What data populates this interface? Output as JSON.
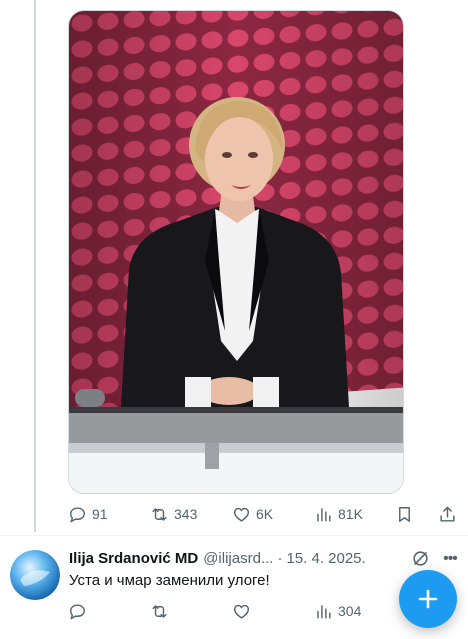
{
  "post": {
    "media": {
      "alt": "News anchor image"
    },
    "stats": {
      "replies": "91",
      "reposts": "343",
      "likes": "6K",
      "views": "81K"
    }
  },
  "reply": {
    "name": "Ilija Srdanović MD",
    "handle": "@ilijasrd...",
    "separator": "·",
    "date": "15. 4. 2025.",
    "text": "Уста и чмар заменили улоге!",
    "views": "304"
  },
  "icons": {
    "reply": "reply-icon",
    "repost": "repost-icon",
    "like": "heart-icon",
    "views": "views-icon",
    "bookmark": "bookmark-icon",
    "share": "share-icon",
    "grok": "grok-icon",
    "more": "more-icon",
    "compose": "plus-icon"
  },
  "colors": {
    "accent": "#1d9bf0",
    "muted": "#536471",
    "text": "#0f1419"
  }
}
